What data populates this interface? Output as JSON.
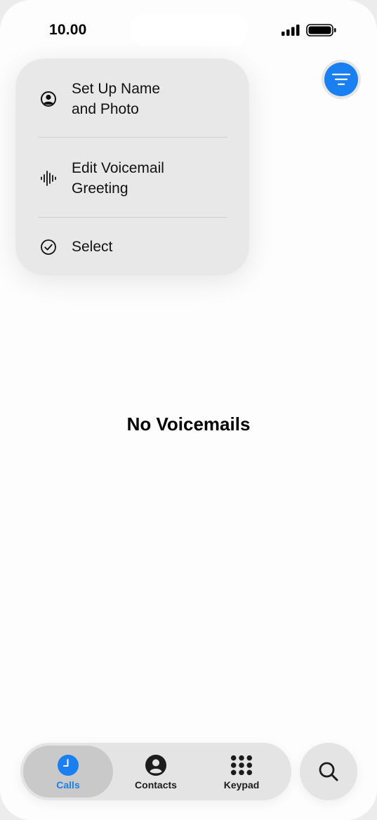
{
  "status_bar": {
    "time": "10.00",
    "signal_icon": "cellular-signal-icon",
    "battery_icon": "battery-icon"
  },
  "header": {
    "filter_button_icon": "filter-icon"
  },
  "menu": {
    "items": [
      {
        "label": "Set Up Name\nand Photo",
        "icon": "person-circle-icon"
      },
      {
        "label": "Edit Voicemail\nGreeting",
        "icon": "waveform-icon"
      },
      {
        "label": "Select",
        "icon": "checkmark-circle-icon"
      }
    ]
  },
  "main": {
    "empty_title": "No Voicemails"
  },
  "tabbar": {
    "tabs": [
      {
        "label": "Calls",
        "icon": "clock-icon",
        "active": true
      },
      {
        "label": "Contacts",
        "icon": "person-icon",
        "active": false
      },
      {
        "label": "Keypad",
        "icon": "keypad-icon",
        "active": false
      }
    ],
    "search_icon": "search-icon"
  },
  "colors": {
    "accent": "#1a7ff0",
    "menu_bg": "#e8e8e8",
    "tabbar_bg": "#e4e4e4",
    "active_tab_bg": "#c9c9c9"
  }
}
